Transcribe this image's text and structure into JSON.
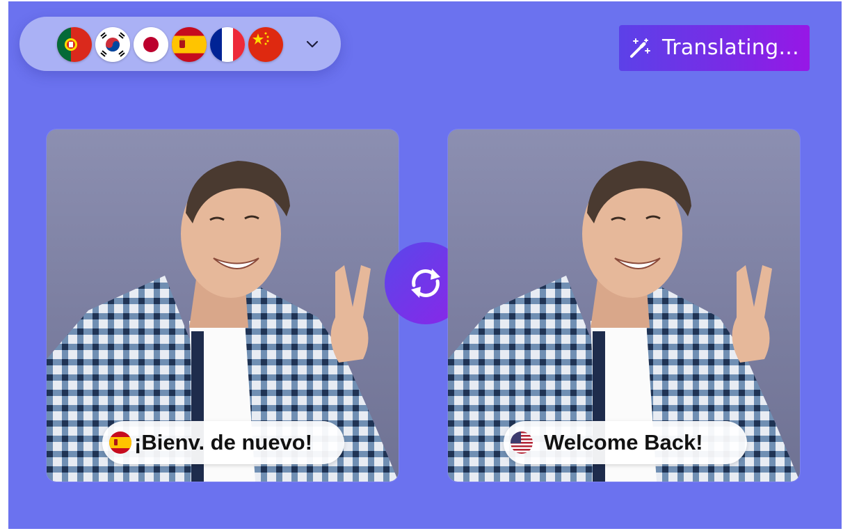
{
  "language_selector": {
    "flags": [
      {
        "icon": "portugal-flag-icon",
        "language": "Portuguese"
      },
      {
        "icon": "south-korea-flag-icon",
        "language": "Korean"
      },
      {
        "icon": "japan-flag-icon",
        "language": "Japanese"
      },
      {
        "icon": "spain-flag-icon",
        "language": "Spanish"
      },
      {
        "icon": "france-flag-icon",
        "language": "French"
      },
      {
        "icon": "china-flag-icon",
        "language": "Chinese"
      }
    ],
    "dropdown_icon": "chevron-down-icon"
  },
  "status_button": {
    "icon": "magic-wand-icon",
    "label": "Translating..."
  },
  "source_panel": {
    "flag_icon": "spain-flag-icon",
    "caption": "¡Bienv. de nuevo!"
  },
  "target_panel": {
    "flag_icon": "usa-flag-icon",
    "caption": "Welcome Back!"
  },
  "swap_button": {
    "icon": "swap-arrows-icon"
  },
  "colors": {
    "background": "#6b72ef",
    "pill": "#aab1f5",
    "accent_start": "#5c41e8",
    "accent_end": "#9717e6"
  }
}
